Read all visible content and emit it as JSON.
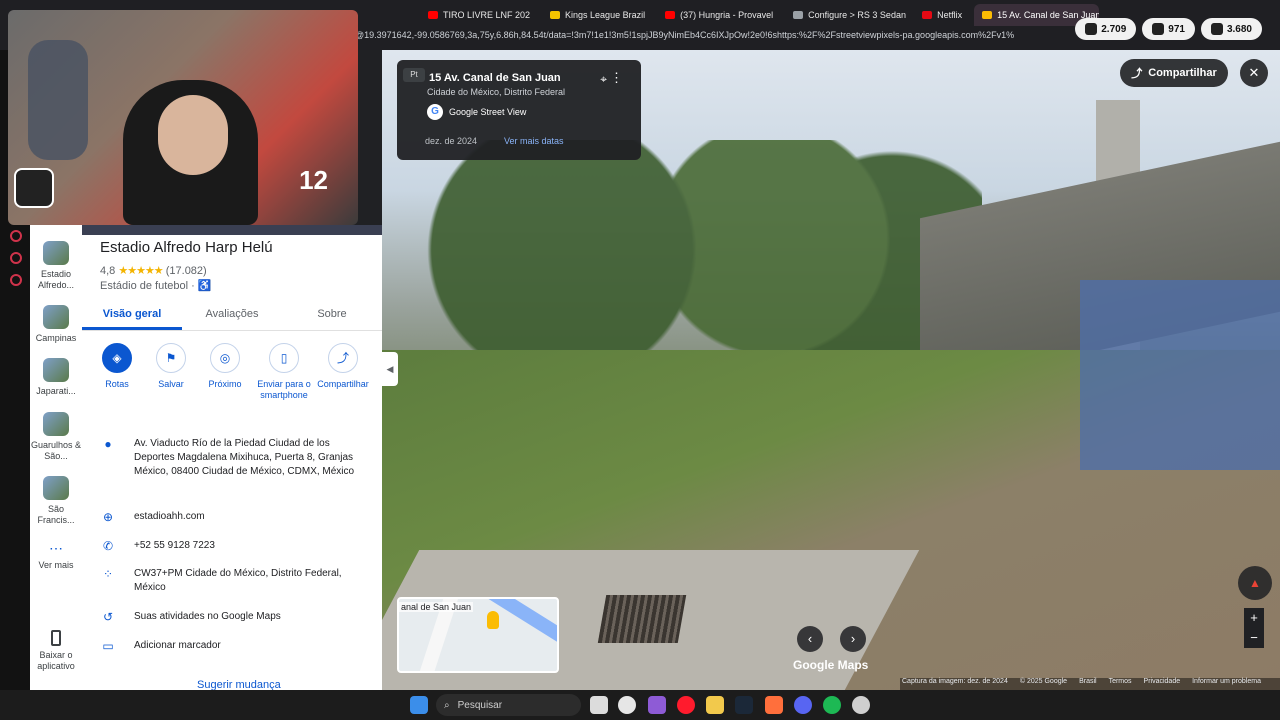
{
  "browser": {
    "tabs": [
      {
        "label": "TIRO LIVRE LNF 202",
        "color": "#ff0000"
      },
      {
        "label": "Kings League Brazil",
        "color": "#f5c400"
      },
      {
        "label": "(37) Hungria - Provavel",
        "color": "#ff0000"
      },
      {
        "label": "Configure > RS 3 Sedan",
        "color": "#9aa0a6"
      },
      {
        "label": "Netflix",
        "color": "#e50914"
      },
      {
        "label": "15 Av. Canal de San Juan",
        "color": "#fbbc04"
      }
    ],
    "url": "@19.3971642,-99.0586769,3a,75y,6.86h,84.54t/data=!3m7!1e1!3m5!1spjJB9yNimEb4Cc6IXJpOw!2e0!6shttps:%2F%2Fstreetviewpixels-pa.googleapis.com%2Fv1%",
    "pills": [
      "2.709",
      "971",
      "3.680"
    ]
  },
  "webcam": {
    "overlay_number": "12"
  },
  "rail": {
    "items": [
      {
        "label": "Estadio Alfredo..."
      },
      {
        "label": "Campinas"
      },
      {
        "label": "Japarati..."
      },
      {
        "label": "Guarulhos & São..."
      },
      {
        "label": "São Francis..."
      },
      {
        "label": "Ver mais"
      },
      {
        "label": "Baixar o aplicativo"
      }
    ]
  },
  "place": {
    "title": "Estadio Alfredo Harp Helú",
    "rating": "4,8",
    "stars": "★★★★★",
    "reviews": "(17.082)",
    "category": "Estádio de futebol · ♿",
    "tabs": [
      "Visão geral",
      "Avaliações",
      "Sobre"
    ],
    "actions": [
      {
        "label": "Rotas",
        "icon": "◈"
      },
      {
        "label": "Salvar",
        "icon": "⚑"
      },
      {
        "label": "Próximo",
        "icon": "◎"
      },
      {
        "label": "Enviar para o smartphone",
        "icon": "▯"
      },
      {
        "label": "Compartilhar",
        "icon": "⤴"
      }
    ],
    "info": [
      {
        "icon": "●",
        "text": "Av. Viaducto Río de la Piedad Ciudad de los Deportes Magdalena Mixihuca, Puerta 8, Granjas México, 08400 Ciudad de México, CDMX, México"
      },
      {
        "icon": "⊕",
        "text": "estadioahh.com"
      },
      {
        "icon": "✆",
        "text": "+52 55 9128 7223"
      },
      {
        "icon": "⁘",
        "text": "CW37+PM Cidade do México, Distrito Federal, México"
      },
      {
        "icon": "↺",
        "text": "Suas atividades no Google Maps"
      },
      {
        "icon": "▭",
        "text": "Adicionar marcador"
      }
    ],
    "suggest": "Sugerir mudança"
  },
  "streetview": {
    "street": "15 Av. Canal de San Juan",
    "city": "Cidade do México, Distrito Federal",
    "provider": "Google Street View",
    "date": "dez. de 2024",
    "more_dates": "Ver mais datas",
    "back_label": "Pt",
    "share": "Compartilhar",
    "brand": "Google Maps",
    "minimap_label": "anal de San Juan",
    "footer": [
      "Captura da imagem: dez. de 2024",
      "© 2025 Google",
      "Brasil",
      "Termos",
      "Privacidade",
      "Informar um problema"
    ]
  },
  "taskbar": {
    "search_placeholder": "Pesquisar"
  }
}
